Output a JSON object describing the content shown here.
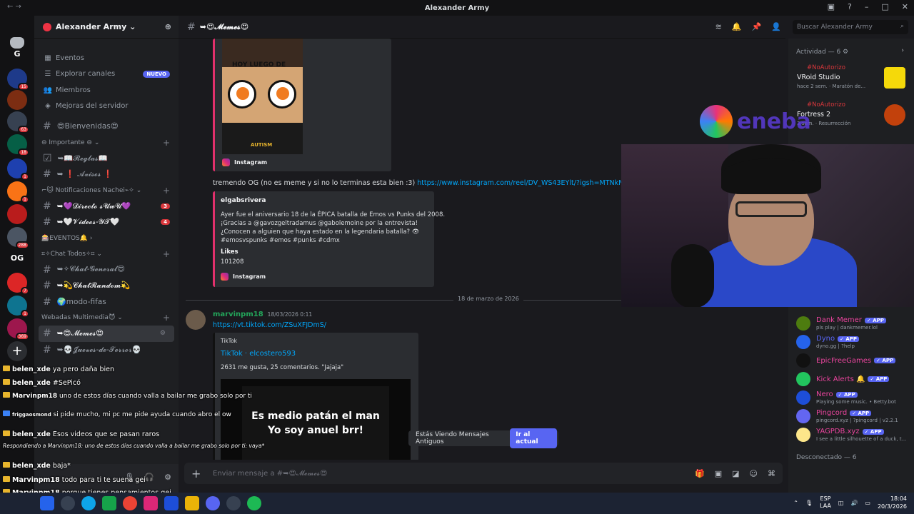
{
  "window": {
    "title": "Alexander Army"
  },
  "server": {
    "name": "Alexander Army ⌄"
  },
  "nav_items": [
    {
      "icon": "calendar-icon",
      "label": "Eventos"
    },
    {
      "icon": "compass-icon",
      "label": "Explorar canales",
      "badge": "NUEVO"
    },
    {
      "icon": "members-icon",
      "label": "Miembros"
    },
    {
      "icon": "boost-icon",
      "label": "Mejoras del servidor"
    }
  ],
  "channels": {
    "bienvenidas": "😍Bienvenidas😍",
    "cat_importante": "⊖ Importante ⊖ ⌄",
    "reglas": "➥📖𝓡𝓮𝓰𝓵𝓪𝓼📖",
    "avisos": "➥ ❗ 𝓐𝓿𝓲𝓼𝓸𝓼 ❗",
    "cat_notificaciones": "⌐🐱 Notificaciones Nachei⌁✧ ⌄",
    "directo": "➥💜𝓓𝓲𝓻𝓮𝓬𝓽𝓸 𝓼𝓤𝔀𝓤💜",
    "directo_count": "3",
    "videos": "➥🤍𝓥𝓲𝓭𝓮𝓸𝓼-𝓨𝓣🤍",
    "videos_count": "4",
    "cat_eventos": "🎰EVENTOS🔔 ›",
    "cat_chat": "⌗✧Chat Todos✧⌗ ⌄",
    "chat_general": "➥✧𝓒𝓱𝓪𝓽-𝓖𝓮𝓷𝓮𝓻𝓪𝓵😍",
    "chat_random": "➥💫𝓒𝓱𝓪𝓽𝓡𝓪𝓷𝓭𝓸𝓶💫",
    "modo_fifas": "🌍modo-fifas",
    "cat_webadas": "Webadas Multimedia😈 ⌄",
    "memes": "➥😍𝓜𝓮𝓶𝓮𝓼😍",
    "jueves": "➥💀𝓙𝓾𝓮𝓿𝓮𝓼-𝓭𝓮-𝓣𝓮𝓻𝓻𝓸𝓻💀"
  },
  "header": {
    "channel": "➥😍𝓜𝓮𝓶𝓮𝓼😍"
  },
  "search": {
    "placeholder": "Buscar Alexander Army"
  },
  "messages": {
    "img_text": "HOY LUEGO DE",
    "img_caption": "AUTISM",
    "ig_label": "Instagram",
    "msg1": "tremendo OG (no es meme y si no lo terminas esta bien :3)",
    "msg1_link": "https://www.instagram.com/reel/DV_WS43EYlt/?igsh=MTNkN2tpd",
    "embed_author": "elgabsrivera",
    "embed_line1": "Ayer fue el aniversario 18 de la ÉPICA batalla de Emos vs Punks del 2008.",
    "embed_line2": "¡Gracias a @gavozgeltradamus @gabolemoine por la entrevista!",
    "embed_line3": "¿Conocen a alguien que haya estado en la legendaria batalla? 👁",
    "embed_line4": "#emosvspunks #emos #punks #cdmx",
    "likes_label": "Likes",
    "likes_value": "101208",
    "date_divider": "18 de marzo de 2026",
    "author2": "marvinpm18",
    "time2": "18/03/2026 0:11",
    "link2": "https://vt.tiktok.com/ZSuXFJDmS/",
    "tt_provider": "TikTok",
    "tt_title": "TikTok · elcostero593",
    "tt_desc": "2631 me gusta, 25 comentarios. \"Jajaja\"",
    "video_line1": "Es medio patán el man",
    "video_line2": "Yo soy anuel brr!"
  },
  "jump": {
    "text": "Estás Viendo Mensajes Antiguos",
    "button": "Ir al actual"
  },
  "composer": {
    "placeholder": "Enviar mensaje a #➥😍𝓜𝓮𝓶𝓮𝓼😍"
  },
  "members": {
    "activity_header": "Actividad — 6 ⚙",
    "act1_tag": "#NoAutorizo",
    "act1_name": "VRoid Studio",
    "act1_sub": "hace 2 sem. · Maratón de...",
    "act2_tag": "#NoAutorizo",
    "act2_name": "Fortress 2",
    "act2_sub": "3 sem. · Resurrección",
    "list": [
      {
        "name": "Dank Memer",
        "sub": "pls play | dankmemer.lol",
        "color": "#eb459e"
      },
      {
        "name": "Dyno",
        "sub": "dyno.gg | ?help",
        "color": "#5865f2"
      },
      {
        "name": "EpicFreeGames",
        "sub": "",
        "color": "#eb459e"
      },
      {
        "name": "Kick Alerts 🔔",
        "sub": "",
        "color": "#eb459e"
      },
      {
        "name": "Nero",
        "sub": "Playing some music. • Betty.bot",
        "color": "#eb459e"
      },
      {
        "name": "Pingcord",
        "sub": "pingcord.xyz | ?pingcord | v2.2.1",
        "color": "#eb459e"
      },
      {
        "name": "YAGPDB.xyz",
        "sub": "I see a little silhouette of a duck, t...",
        "color": "#eb459e"
      }
    ],
    "app_badge": "✓ APP",
    "offline_header": "Desconectado — 6"
  },
  "overlay_chat": [
    {
      "user": "belen_xde",
      "text": "ya pero daña bien"
    },
    {
      "user": "belen_xde",
      "text": "#SePicó"
    },
    {
      "user": "Marvinpm18",
      "text": "uno de estos días cuando valla a bailar me grabo solo por ti"
    },
    {
      "user": "friggaosmond",
      "text": "si pide mucho, mi pc me pide ayuda cuando abro el ow"
    },
    {
      "user": "belen_xde",
      "text": "Esos videos que se pasan raros"
    },
    {
      "user": "",
      "text": "Respondiendo a Marvinpm18: uno de estos días cuando valla a bailar me grabo solo por ti: vaya*"
    },
    {
      "user": "belen_xde",
      "text": "baja*"
    },
    {
      "user": "Marvinpm18",
      "text": "todo para ti te suena gei"
    },
    {
      "user": "Marvinpm18",
      "text": "porque tienes pensamientos gei"
    },
    {
      "user": "belen_xde",
      "text": "Mis papis"
    }
  ],
  "logo": {
    "text": "eneba"
  },
  "tray": {
    "lang1": "ESP",
    "lang2": "LAA",
    "time": "18:04",
    "date": "20/3/2026"
  },
  "guild_badges": [
    "15",
    "63",
    "18",
    "1",
    "1",
    "288",
    "7",
    "1",
    "369"
  ],
  "guild_letters": {
    "g": "G",
    "og": "OG"
  },
  "colors": {
    "accent": "#5865f2",
    "danger": "#da373c",
    "link": "#00a8fc",
    "ig": "#e1306c",
    "member_green": "#23a55a"
  }
}
